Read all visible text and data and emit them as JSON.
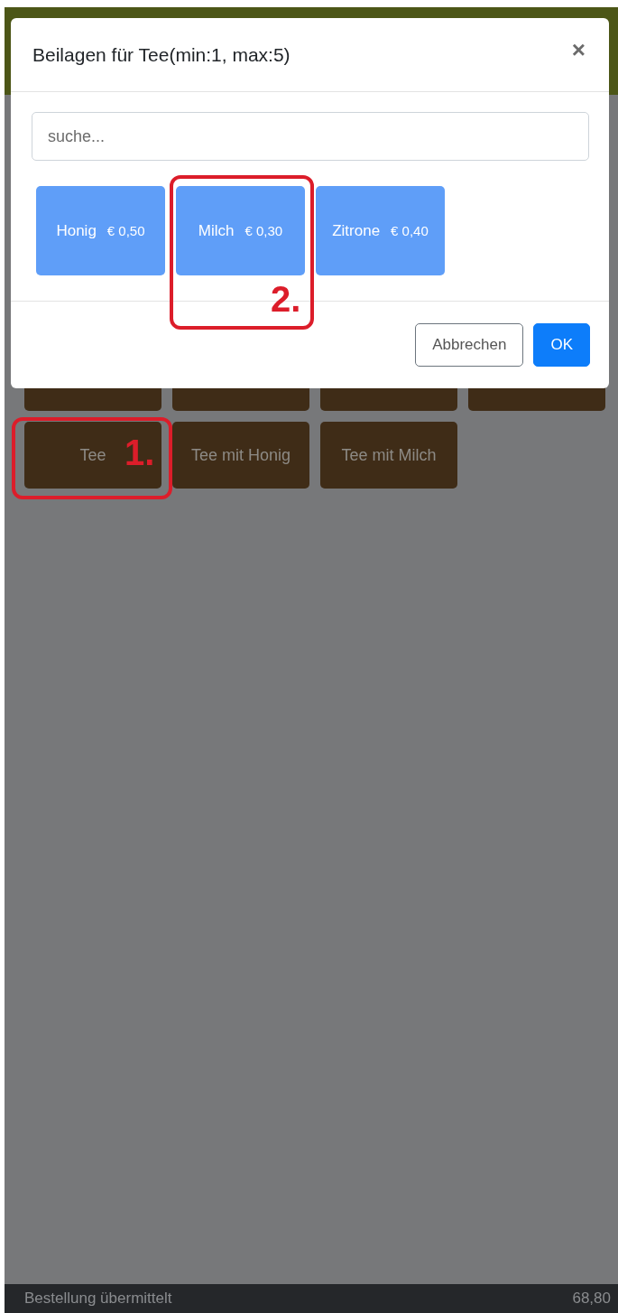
{
  "dialog": {
    "title": "Beilagen für Tee(min:1, max:5)",
    "close": "×",
    "search": {
      "placeholder": "suche..."
    },
    "addons": [
      {
        "name": "Honig",
        "price": "€ 0,50"
      },
      {
        "name": "Milch",
        "price": "€ 0,30"
      },
      {
        "name": "Zitrone",
        "price": "€ 0,40"
      }
    ],
    "buttons": [
      {
        "label": "Abbrechen",
        "kind": "secondary"
      },
      {
        "label": "OK",
        "kind": "primary"
      }
    ]
  },
  "products": [
    {
      "label": "Tee"
    },
    {
      "label": "Tee mit Honig"
    },
    {
      "label": "Tee mit Milch"
    }
  ],
  "annotations": [
    {
      "label": "1.",
      "kind": "product"
    },
    {
      "label": "2.",
      "kind": "addon"
    }
  ],
  "status_bar": {
    "text": "Bestellung übermittelt",
    "total": "68,80"
  }
}
